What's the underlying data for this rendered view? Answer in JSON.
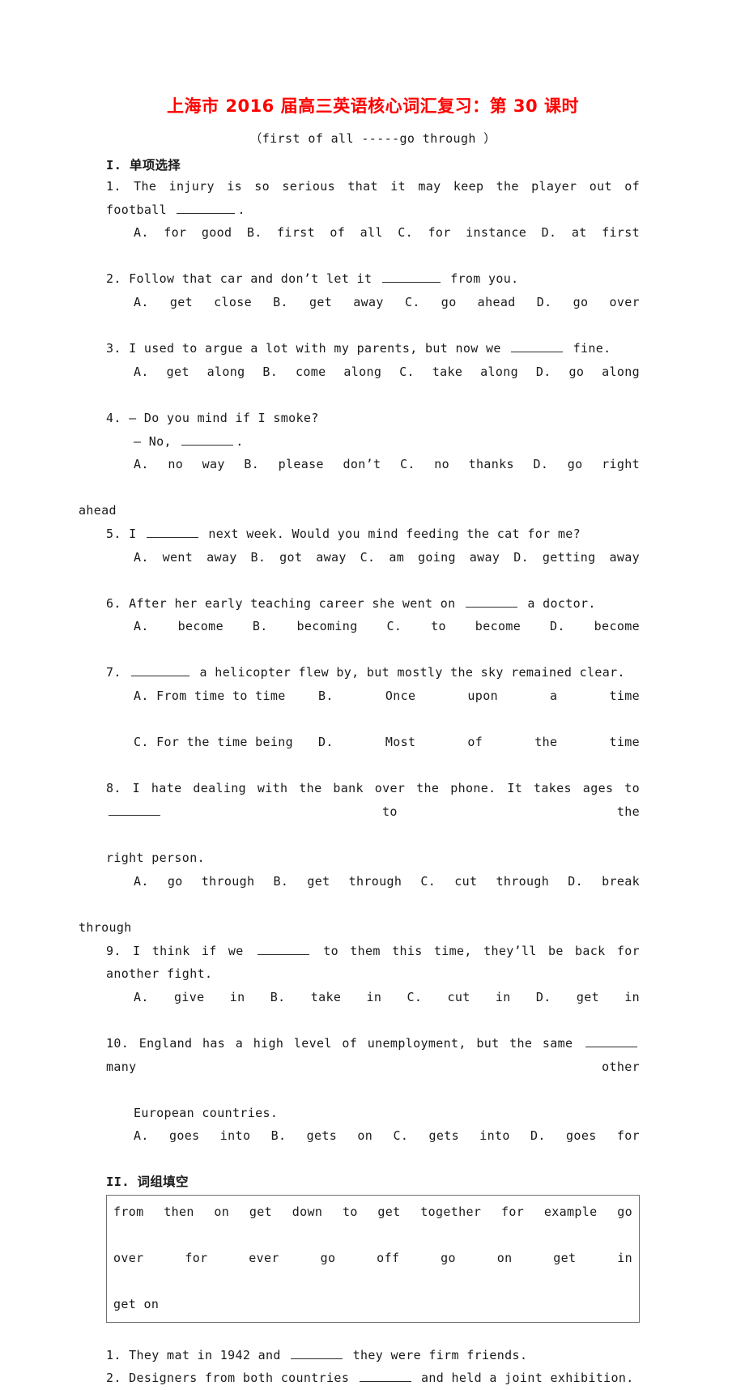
{
  "document": {
    "title": "上海市 2016 届高三英语核心词汇复习：第 30 课时",
    "title_color": "#ff0000",
    "subtitle": "（first of all -----go through ）"
  },
  "sections": [
    {
      "heading_numeral": "I.",
      "heading_label": "单项选择",
      "questions": [
        {
          "number": "1.",
          "stem_before": "The injury is so serious that it may keep the player out of football",
          "stem_after": ".",
          "options": [
            "A. for good",
            "B. first of all",
            "C. for instance",
            "D. at first"
          ],
          "layout": "one-row-justified"
        },
        {
          "number": "2.",
          "stem_before": "Follow that car and don’t let it",
          "stem_after": "from you.",
          "options": [
            "A. get close",
            "B. get away",
            "C. go ahead",
            "D. go over"
          ],
          "layout": "one-row-justified"
        },
        {
          "number": "3.",
          "stem_before": "I used to argue a lot with my parents, but now we",
          "stem_after": "fine.",
          "options": [
            "A. get along",
            "B. come along",
            "C. take along",
            "D. go along"
          ],
          "layout": "one-row-justified"
        },
        {
          "number": "4.",
          "stem_line_1": "— Do you mind if I smoke?",
          "stem_line_2_before": "— No,",
          "stem_line_2_after": ".",
          "options": [
            "A. no way",
            "B. please don’t",
            "C. no thanks",
            "D.  go  right"
          ],
          "options_overflow": "ahead",
          "layout": "one-row-overflow"
        },
        {
          "number": "5.",
          "stem_before": "I",
          "stem_after": "next week. Would you mind feeding the cat for me?",
          "options": [
            "A. went away",
            "B. got away",
            "C. am going away",
            "D. getting away"
          ],
          "layout": "one-row-justified"
        },
        {
          "number": "6.",
          "stem_before": "After her early teaching career she went on",
          "stem_after": "a doctor.",
          "options": [
            "A. become",
            "B. becoming",
            "C. to become",
            "D. become"
          ],
          "layout": "one-row-justified"
        },
        {
          "number": "7.",
          "stem_before": "",
          "stem_after": "a helicopter flew by, but mostly the sky remained clear.",
          "options": [
            "A. From time to time",
            "B. Once upon a time",
            "C. For the time being",
            "D. Most of the time"
          ],
          "layout": "two-rows"
        },
        {
          "number": "8.",
          "stem_before": "I hate dealing with the bank over the phone. It takes ages to",
          "stem_after": "to the",
          "stem_overflow": "right person.",
          "options": [
            "A. go through",
            "B. get through",
            "C. cut through",
            "D.  break"
          ],
          "options_overflow": "through",
          "layout": "one-row-overflow"
        },
        {
          "number": "9.",
          "stem_before": "I think if we",
          "stem_after": "to them this time, they’ll be back for another fight.",
          "options": [
            "A. give in",
            "B. take in",
            "C. cut in",
            "D. get in"
          ],
          "layout": "one-row-justified"
        },
        {
          "number": "10.",
          "stem_before": "England has a high level of unemployment, but the same",
          "stem_after": "many other",
          "stem_overflow": "European countries.",
          "options": [
            "A. goes into",
            "B. gets on",
            "C. gets into",
            "D. goes for"
          ],
          "layout": "one-row-justified"
        }
      ]
    },
    {
      "heading_numeral": "II.",
      "heading_label": "词组填空",
      "word_bank": {
        "rows": [
          [
            "from then on",
            "get down to",
            "get together",
            "for example",
            "go"
          ],
          [
            "over",
            "for ever",
            "go off",
            "go on",
            "get in"
          ],
          [
            "get on"
          ]
        ]
      },
      "fill_questions": [
        {
          "number": "1.",
          "text_before": "They mat in 1942 and",
          "text_after": "they were firm friends."
        },
        {
          "number": "2.",
          "text_before": "Designers from both countries",
          "text_after": "and held a joint exhibition."
        }
      ]
    }
  ]
}
